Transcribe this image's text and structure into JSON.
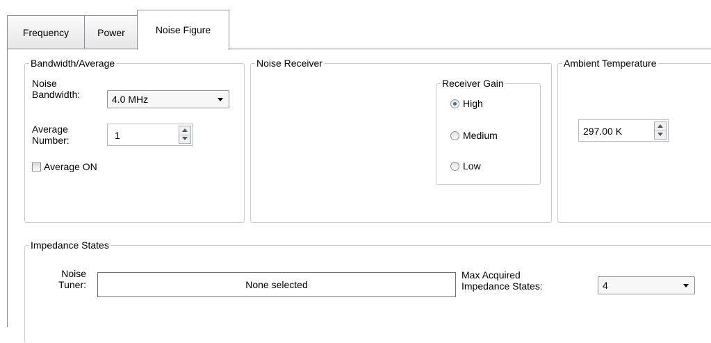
{
  "tabs": [
    {
      "label": "Frequency"
    },
    {
      "label": "Power"
    },
    {
      "label": "Noise Figure",
      "active": true
    }
  ],
  "bandwidth_average": {
    "legend": "Bandwidth/Average",
    "noise_bandwidth_label": "Noise\nBandwidth:",
    "noise_bandwidth_value": "4.0 MHz",
    "average_number_label": "Average\nNumber:",
    "average_number_value": "1",
    "average_on_label": "Average ON",
    "average_on_checked": false
  },
  "noise_receiver": {
    "legend": "Noise Receiver",
    "receiver_gain": {
      "legend": "Receiver Gain",
      "options": [
        "High",
        "Medium",
        "Low"
      ],
      "selected": "High"
    }
  },
  "ambient_temperature": {
    "legend": "Ambient Temperature",
    "value": "297.00 K"
  },
  "impedance_states": {
    "legend": "Impedance States",
    "noise_tuner_label": "Noise\nTuner:",
    "noise_tuner_value": "None selected",
    "max_states_label": "Max Acquired\nImpedance States:",
    "max_states_value": "4"
  }
}
